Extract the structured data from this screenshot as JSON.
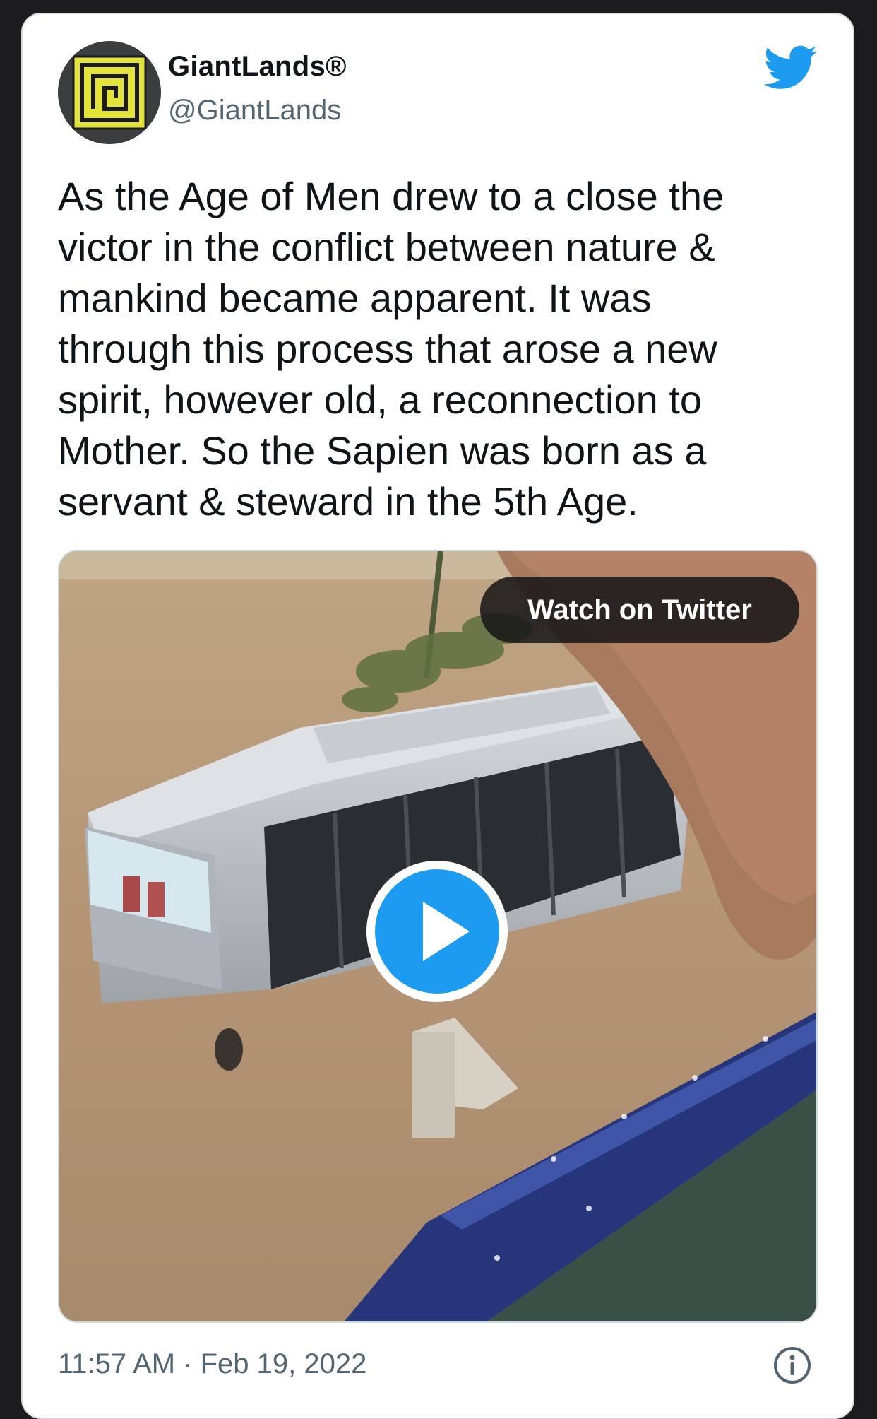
{
  "tweet": {
    "display_name": "GiantLands®",
    "handle": "@GiantLands",
    "text": "As the Age of Men drew to a close the\nvictor in the conflict between nature &\nmankind became apparent. It was\nthrough this process that arose a new\nspirit, however old, a reconnection to\nMother. So the Sapien was born as a\nservant & steward in the 5th Age.",
    "timestamp": "11:57 AM · Feb 19, 2022"
  },
  "media": {
    "type": "video",
    "watch_label": "Watch on Twitter",
    "description_icon": "play-icon"
  },
  "icons": {
    "brand": "twitter-bird-icon",
    "info": "info-icon",
    "avatar_logo": "giantlands-logo"
  },
  "colors": {
    "twitter_blue": "#1d9bf0",
    "text_primary": "#0f1419",
    "text_secondary": "#536471",
    "avatar_yellow": "#e8e83a"
  }
}
